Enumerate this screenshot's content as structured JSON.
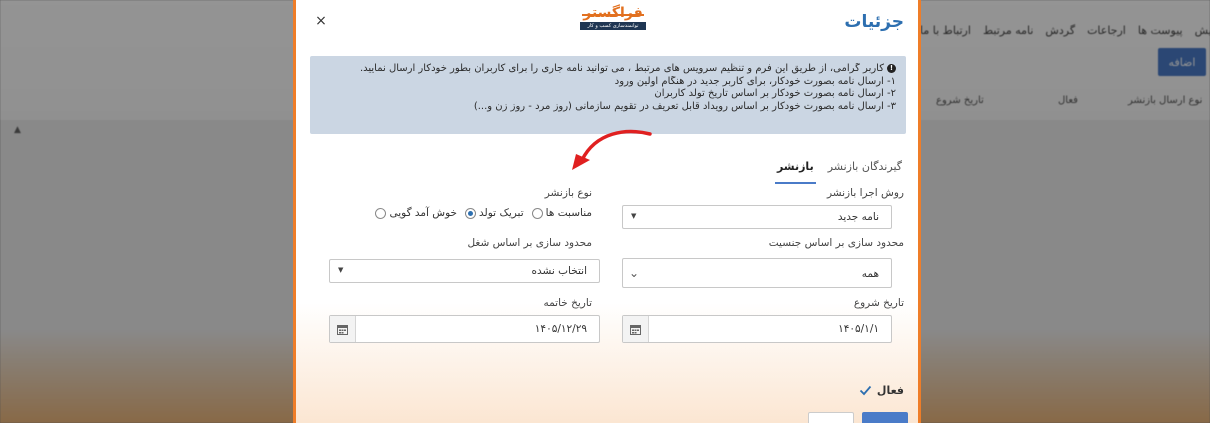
{
  "background": {
    "nav_items": [
      "ارتباط با ما",
      "نامه مرتبط",
      "گردش",
      "ارجاعات",
      "پیوست ها",
      "نمایش"
    ],
    "add_button": "اضافه",
    "headers": [
      "نوع ارسال بازنشر",
      "فعال",
      "تاریخ شروع"
    ]
  },
  "modal": {
    "title": "جزئیات",
    "close_label": "×",
    "logo": {
      "name": "فراگستر",
      "tagline": "توانمندسازی کسب و کار"
    },
    "info": {
      "lines": [
        "کاربر گرامی، از طریق این فرم و تنظیم سرویس های مرتبط ، می توانید نامه جاری را برای کاربران بطور خودکار ارسال نمایید.",
        "۱- ارسال نامه بصورت خودکار، برای کاربر جدید در هنگام اولین ورود",
        "۲- ارسال نامه بصورت خودکار بر اساس تاریخ تولد کاربران",
        "۳- ارسال نامه بصورت خودکار بر اساس رویداد قابل تعریف در تقویم سازمانی (روز مرد - روز زن و...)"
      ]
    },
    "tabs": [
      {
        "label": "بازنشر",
        "active": true
      },
      {
        "label": "گیرندگان بازنشر",
        "active": false
      }
    ],
    "fields": {
      "execution_method": {
        "label": "روش اجرا بازنشر",
        "value": "نامه جدید"
      },
      "republish_type": {
        "label": "نوع بازنشر",
        "options": [
          {
            "label": "خوش آمد گویی",
            "selected": false
          },
          {
            "label": "تبریک تولد",
            "selected": true
          },
          {
            "label": "مناسبت ها",
            "selected": false
          }
        ]
      },
      "gender_limit": {
        "label": "محدود سازی بر اساس جنسیت",
        "value": "همه"
      },
      "job_limit": {
        "label": "محدود سازی بر اساس شغل",
        "value": "انتخاب نشده"
      },
      "start_date": {
        "label": "تاریخ شروع",
        "value": "۱۴۰۵/۱/۱"
      },
      "end_date": {
        "label": "تاریخ خاتمه",
        "value": "۱۴۰۵/۱۲/۲۹"
      },
      "active": {
        "label": "فعال",
        "checked": true
      }
    }
  },
  "colors": {
    "accent": "#4a7bc8",
    "title": "#2d6fb0",
    "border": "#ef7d28",
    "info_bg": "#cbd6e3",
    "arrow": "#e02020"
  }
}
